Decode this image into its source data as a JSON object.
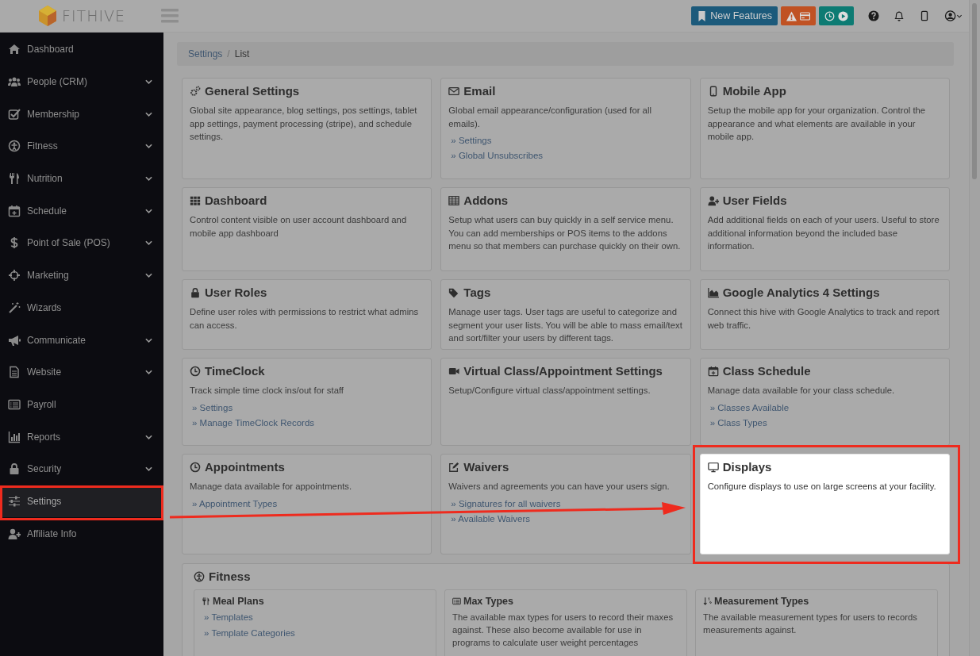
{
  "brand": "FITHIVE",
  "topbar": {
    "buttons": [
      {
        "kind": "features",
        "label": "New Features"
      },
      {
        "kind": "alert"
      },
      {
        "kind": "timeclock"
      }
    ]
  },
  "sidebar": {
    "items": [
      {
        "label": "Dashboard",
        "expandable": false,
        "selected": false
      },
      {
        "label": "People (CRM)",
        "expandable": true,
        "selected": false
      },
      {
        "label": "Membership",
        "expandable": true,
        "selected": false
      },
      {
        "label": "Fitness",
        "expandable": true,
        "selected": false
      },
      {
        "label": "Nutrition",
        "expandable": true,
        "selected": false
      },
      {
        "label": "Schedule",
        "expandable": true,
        "selected": false
      },
      {
        "label": "Point of Sale (POS)",
        "expandable": true,
        "selected": false
      },
      {
        "label": "Marketing",
        "expandable": true,
        "selected": false
      },
      {
        "label": "Wizards",
        "expandable": false,
        "selected": false
      },
      {
        "label": "Communicate",
        "expandable": true,
        "selected": false
      },
      {
        "label": "Website",
        "expandable": true,
        "selected": false
      },
      {
        "label": "Payroll",
        "expandable": false,
        "selected": false
      },
      {
        "label": "Reports",
        "expandable": true,
        "selected": false
      },
      {
        "label": "Security",
        "expandable": true,
        "selected": false
      },
      {
        "label": "Settings",
        "expandable": false,
        "selected": true
      },
      {
        "label": "Affiliate Info",
        "expandable": false,
        "selected": false
      }
    ]
  },
  "breadcrumb": {
    "items": [
      "Settings",
      "List"
    ],
    "separator": "/"
  },
  "cards": [
    {
      "title": "General Settings",
      "description": "Global site appearance, blog settings, pos settings, tablet app settings, payment processing (stripe), and schedule settings.",
      "highlighted": false
    },
    {
      "title": "Email",
      "description": "Global email appearance/configuration (used for all emails).",
      "links": [
        "» Settings",
        "» Global Unsubscribes"
      ],
      "highlighted": false
    },
    {
      "title": "Mobile App",
      "description": "Setup the mobile app for your organization. Control the appearance and what elements are available in your mobile app.",
      "highlighted": false
    },
    {
      "title": "Dashboard",
      "description": "Control content visible on user account dashboard and mobile app dashboard",
      "highlighted": false
    },
    {
      "title": "Addons",
      "description": "Setup what users can buy quickly in a self service menu. You can add memberships or POS items to the addons menu so that members can purchase quickly on their own.",
      "highlighted": false
    },
    {
      "title": "User Fields",
      "description": "Add additional fields on each of your users. Useful to store additional information beyond the included base information.",
      "highlighted": false
    },
    {
      "title": "User Roles",
      "description": "Define user roles with permissions to restrict what admins can access.",
      "highlighted": false
    },
    {
      "title": "Tags",
      "description": "Manage user tags. User tags are useful to categorize and segment your user lists. You will be able to mass email/text and sort/filter your users by different tags.",
      "highlighted": false
    },
    {
      "title": "Google Analytics 4 Settings",
      "description": "Connect this hive with Google Analytics to track and report web traffic.",
      "highlighted": false
    },
    {
      "title": "TimeClock",
      "description": "Track simple time clock ins/out for staff",
      "links": [
        "» Settings",
        "» Manage TimeClock Records"
      ],
      "highlighted": false
    },
    {
      "title": "Virtual Class/Appointment Settings",
      "description": "Setup/Configure virtual class/appointment settings.",
      "highlighted": false
    },
    {
      "title": "Class Schedule",
      "description": "Manage data available for your class schedule.",
      "links": [
        "» Classes Available",
        "» Class Types"
      ],
      "highlighted": false
    },
    {
      "title": "Appointments",
      "description": "Manage data available for appointments.",
      "links": [
        "» Appointment Types"
      ],
      "highlighted": false
    },
    {
      "title": "Waivers",
      "description": "Waivers and agreements you can have your users sign.",
      "links": [
        "» Signatures for all waivers",
        "» Available Waivers"
      ],
      "highlighted": false
    },
    {
      "title": "Displays",
      "description": "Configure displays to use on large screens at your facility.",
      "highlighted": true
    }
  ],
  "fitness": {
    "title": "Fitness",
    "cards": [
      {
        "title": "Meal Plans",
        "links": [
          "» Templates",
          "» Template Categories"
        ]
      },
      {
        "title": "Max Types",
        "description": "The available max types for users to record their maxes against. These also become available for use in programs to calculate user weight percentages"
      },
      {
        "title": "Measurement Types",
        "description": "The available measurement types for users to records measurements against."
      }
    ]
  }
}
